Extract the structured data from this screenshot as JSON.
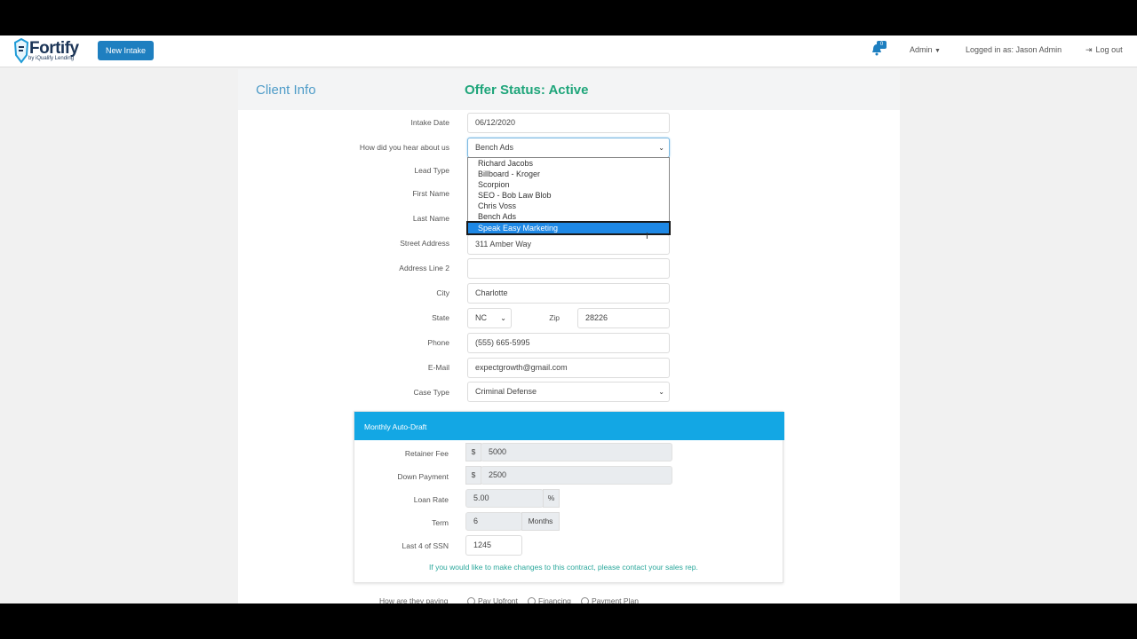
{
  "header": {
    "logo_text": "Fortify",
    "logo_sub": "by iQualify Lending",
    "new_intake_label": "New Intake",
    "notification_count": "0",
    "admin_label": "Admin",
    "logged_in_text": "Logged in as: Jason Admin",
    "logout_label": "Log out"
  },
  "panel": {
    "title": "Client Info",
    "offer_status": "Offer Status: Active"
  },
  "form": {
    "intake_date": {
      "label": "Intake Date",
      "value": "06/12/2020"
    },
    "hear_about": {
      "label": "How did you hear about us",
      "value": "Bench Ads"
    },
    "lead_type": {
      "label": "Lead Type"
    },
    "first_name": {
      "label": "First Name"
    },
    "last_name": {
      "label": "Last Name"
    },
    "street": {
      "label": "Street Address",
      "value": "311 Amber Way"
    },
    "address2": {
      "label": "Address Line 2",
      "value": ""
    },
    "city": {
      "label": "City",
      "value": "Charlotte"
    },
    "state": {
      "label": "State",
      "value": "NC"
    },
    "zip": {
      "label": "Zip",
      "value": "28226"
    },
    "phone": {
      "label": "Phone",
      "value": "(555) 665-5995"
    },
    "email": {
      "label": "E-Mail",
      "value": "expectgrowth@gmail.com"
    },
    "case_type": {
      "label": "Case Type",
      "value": "Criminal Defense"
    }
  },
  "dropdown": {
    "options": [
      "Richard Jacobs",
      "Billboard - Kroger",
      "Scorpion",
      "SEO - Bob Law Blob",
      "Chris Voss",
      "Bench Ads",
      "Speak Easy Marketing"
    ],
    "highlighted": "Speak Easy Marketing"
  },
  "autodraft": {
    "title": "Monthly Auto-Draft",
    "retainer_fee": {
      "label": "Retainer Fee",
      "prefix": "$",
      "value": "5000"
    },
    "down_payment": {
      "label": "Down Payment",
      "prefix": "$",
      "value": "2500"
    },
    "loan_rate": {
      "label": "Loan Rate",
      "value": "5.00",
      "suffix": "%"
    },
    "term": {
      "label": "Term",
      "value": "6",
      "suffix": "Months"
    },
    "ssn": {
      "label": "Last 4 of SSN",
      "value": "1245"
    },
    "note": "If you would like to make changes to this contract, please contact your sales rep."
  },
  "payment": {
    "label": "How are they paying",
    "options": [
      "Pay Upfront",
      "Financing",
      "Payment Plan"
    ]
  }
}
